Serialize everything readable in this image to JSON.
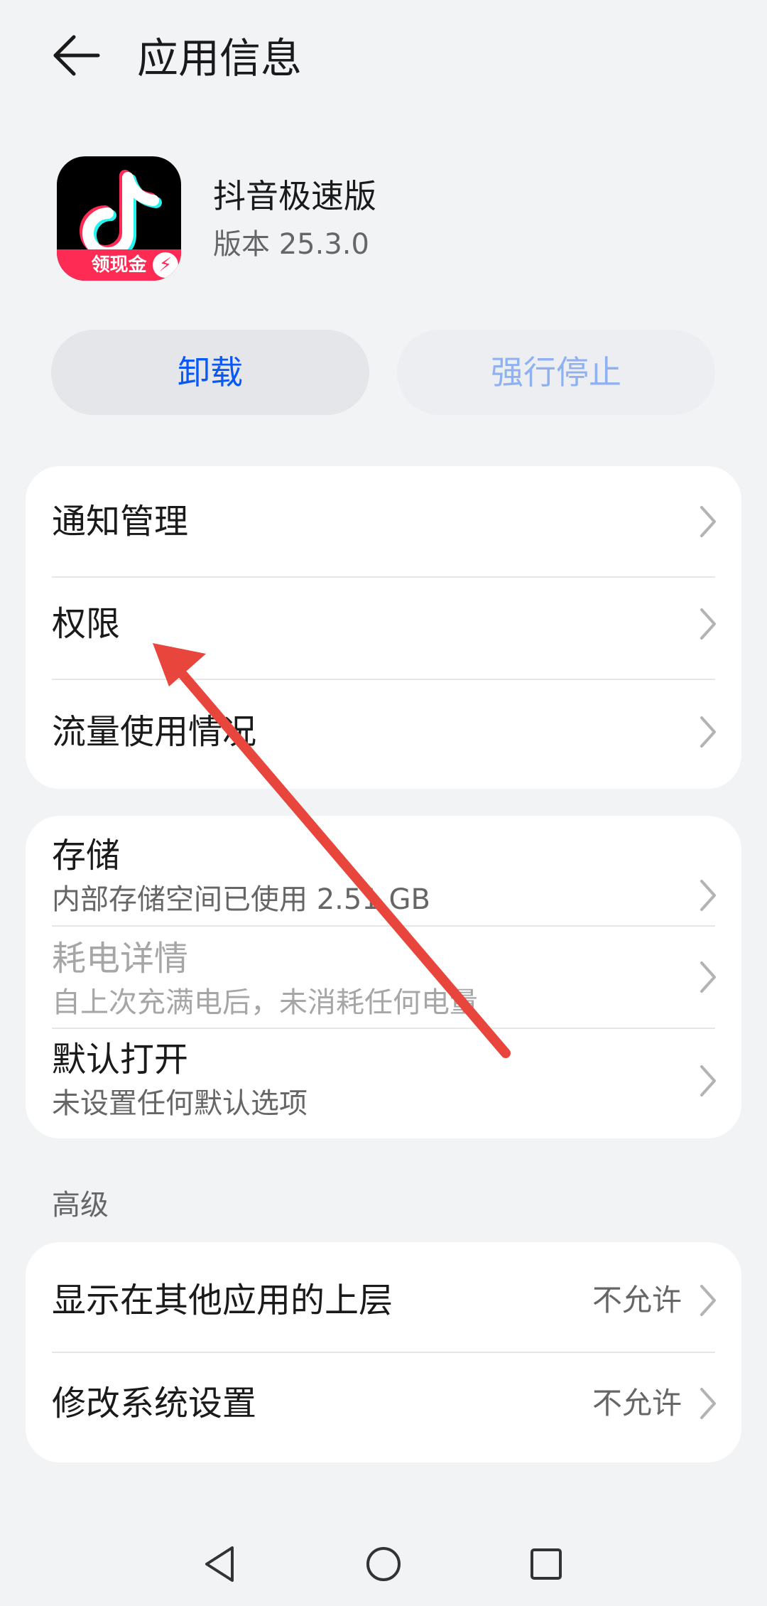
{
  "header": {
    "title": "应用信息"
  },
  "app": {
    "name": "抖音极速版",
    "version": "版本 25.3.0",
    "badge": "领现金"
  },
  "actions": {
    "uninstall": "卸载",
    "force_stop": "强行停止"
  },
  "card1": {
    "items": [
      {
        "label": "通知管理"
      },
      {
        "label": "权限"
      },
      {
        "label": "流量使用情况"
      }
    ]
  },
  "card2": {
    "items": [
      {
        "label": "存储",
        "sub": "内部存储空间已使用 2.51 GB"
      },
      {
        "label": "耗电详情",
        "sub": "自上次充满电后，未消耗任何电量"
      },
      {
        "label": "默认打开",
        "sub": "未设置任何默认选项"
      }
    ]
  },
  "advanced": {
    "section_label": "高级",
    "items": [
      {
        "label": "显示在其他应用的上层",
        "value": "不允许"
      },
      {
        "label": "修改系统设置",
        "value": "不允许"
      }
    ]
  },
  "colors": {
    "accent": "#0a59f7",
    "arrow": "#e8453c",
    "background": "#f1f3f5"
  }
}
